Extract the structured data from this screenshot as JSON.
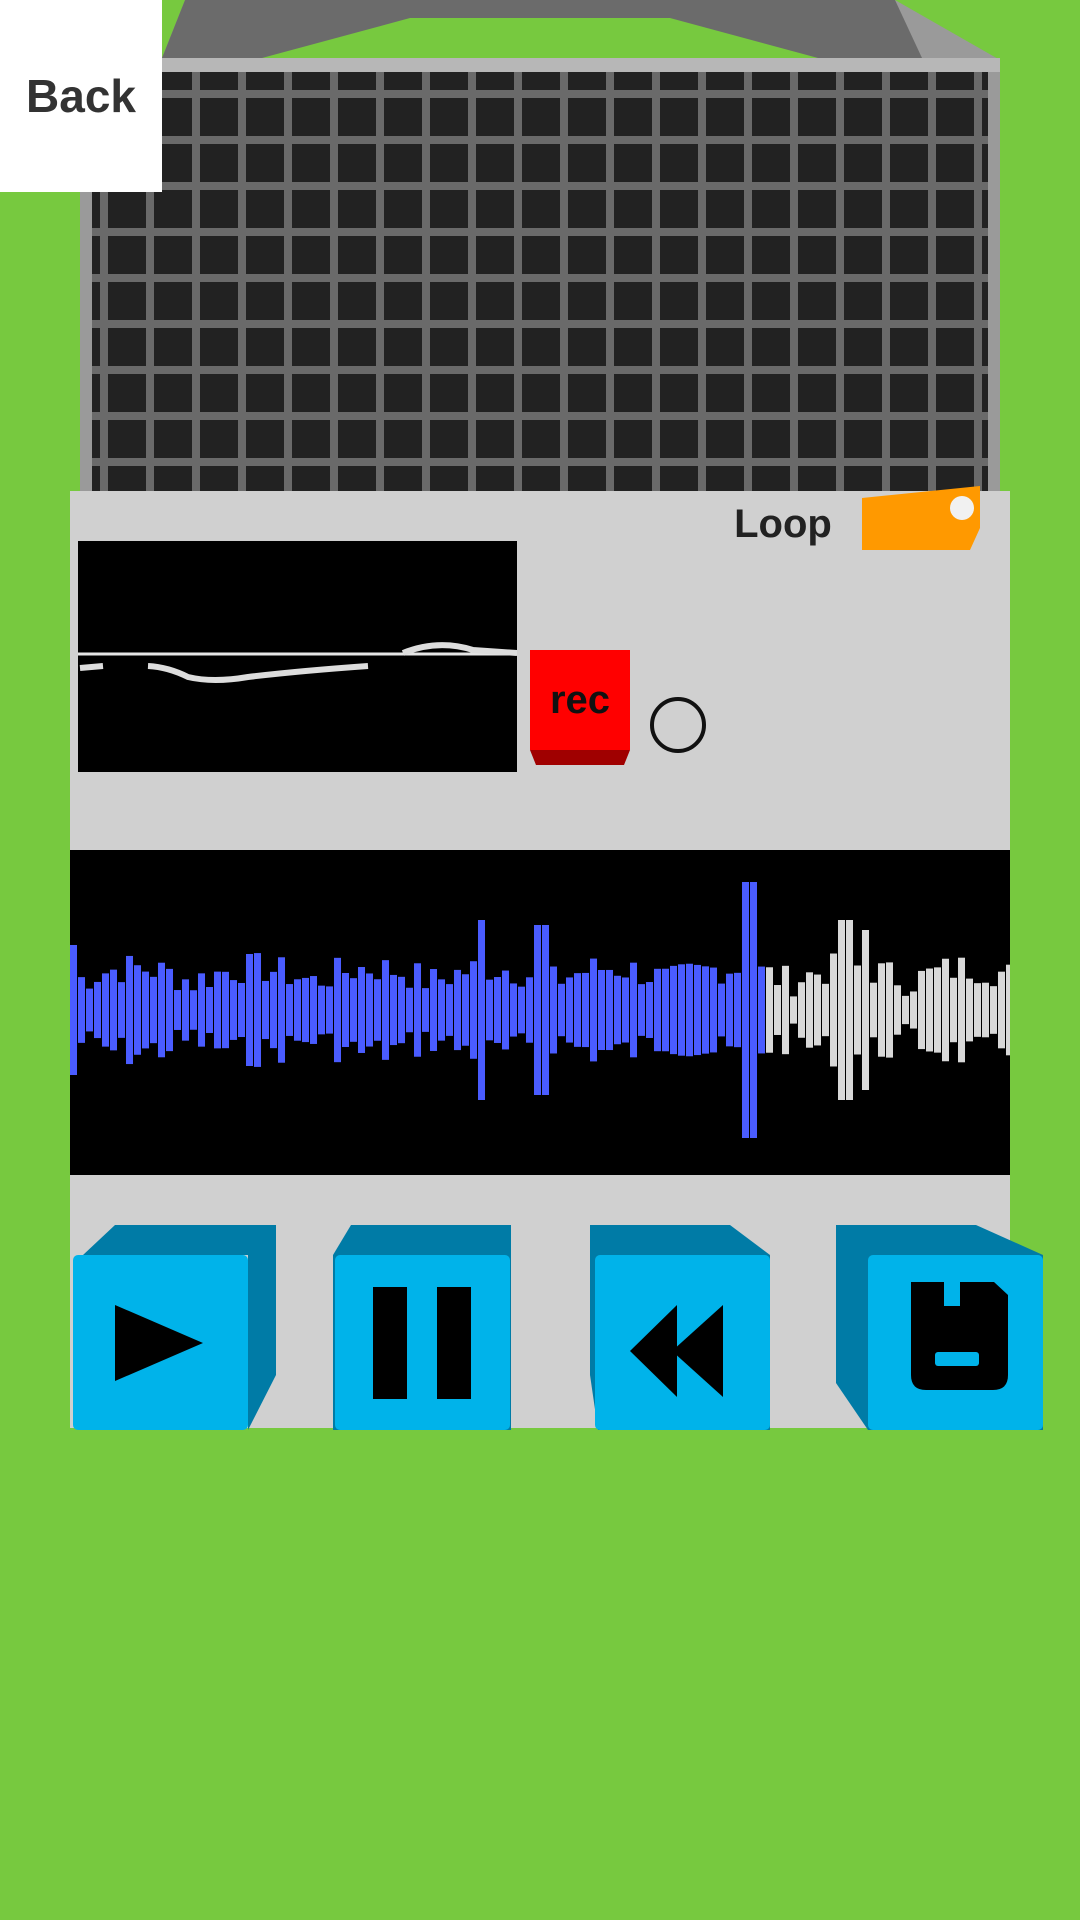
{
  "nav": {
    "back_label": "Back"
  },
  "recorder": {
    "loop_label": "Loop",
    "loop_enabled": true,
    "rec_label": "rec",
    "playback_progress": 0.74
  },
  "controls": [
    "play-icon",
    "pause-icon",
    "rewind-icon",
    "save-icon"
  ],
  "colors": {
    "background": "#77c93f",
    "panel": "#d0d0d0",
    "speaker_grill": "#3a3a3a",
    "rec_button": "#ff0000",
    "loop_toggle": "#ff9900",
    "control_face": "#00b3ea",
    "control_side": "#007ba6",
    "waveform_played": "#4a5cff",
    "waveform_unplayed": "#d8d8d8"
  }
}
